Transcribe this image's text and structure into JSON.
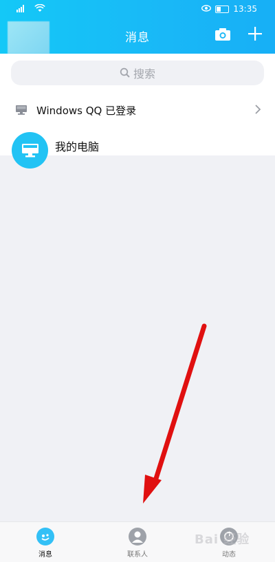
{
  "status_bar": {
    "signal_text": "⁴ᴳ",
    "time": "13:35"
  },
  "header": {
    "title": "消息"
  },
  "search": {
    "placeholder": "搜索"
  },
  "windows_login": {
    "label": "Windows QQ 已登录"
  },
  "chats": [
    {
      "name": "我的电脑"
    }
  ],
  "tabbar": {
    "items": [
      {
        "label": "消息",
        "active": true
      },
      {
        "label": "联系人",
        "active": false
      },
      {
        "label": "动态",
        "active": false
      }
    ]
  },
  "watermark": {
    "text": "Bai 经验"
  },
  "colors": {
    "header_blue": "#17bff7",
    "accent_blue": "#22c3f4",
    "arrow_red": "#e01010"
  }
}
